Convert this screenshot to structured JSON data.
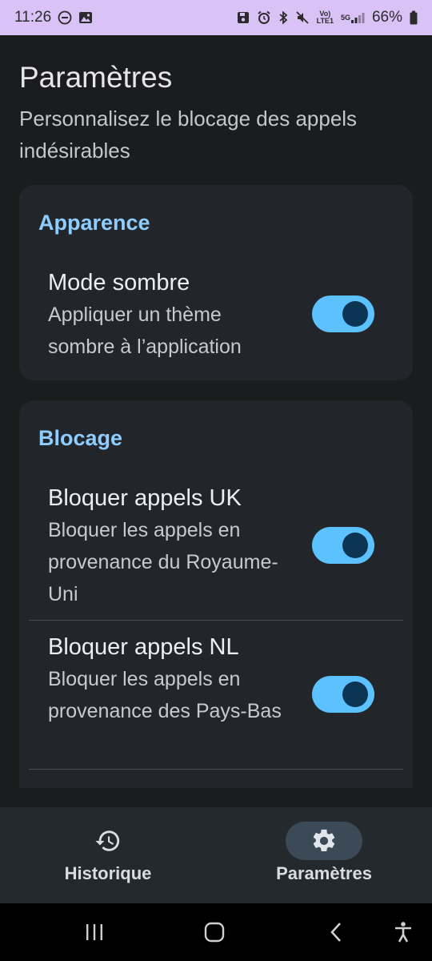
{
  "status_bar": {
    "time": "11:26",
    "network_top": "Vo)",
    "network_bottom": "LTE1",
    "signal_top": "5G",
    "battery": "66%",
    "icons": [
      "do-not-disturb-icon",
      "gallery-icon",
      "save-icon",
      "alarm-icon",
      "bluetooth-icon",
      "mute-icon",
      "signal-icon",
      "battery-icon"
    ]
  },
  "header": {
    "title": "Paramètres",
    "subtitle": "Personnalisez le blocage des appels indésirables"
  },
  "sections": [
    {
      "title": "Apparence",
      "settings": [
        {
          "title": "Mode sombre",
          "description": "Appliquer un thème sombre à l’application",
          "enabled": true
        }
      ]
    },
    {
      "title": "Blocage",
      "settings": [
        {
          "title": "Bloquer appels UK",
          "description": "Bloquer les appels en provenance du Royaume-Uni",
          "enabled": true
        },
        {
          "title": "Bloquer appels NL",
          "description": "Bloquer les appels en provenance des Pays-Bas",
          "enabled": true
        }
      ]
    }
  ],
  "bottom_nav": {
    "items": [
      {
        "label": "Historique",
        "icon": "history-icon",
        "active": false
      },
      {
        "label": "Paramètres",
        "icon": "settings-icon",
        "active": true
      }
    ]
  },
  "system_nav": {
    "buttons": [
      "recent-apps-icon",
      "home-icon",
      "back-icon",
      "accessibility-icon"
    ]
  },
  "colors": {
    "background": "#1a1c1e",
    "card": "#22262b",
    "accent": "#8fcdff",
    "toggle_track": "#5cc1ff",
    "toggle_knob": "#0c3553",
    "status_bar": "#d9c2f5"
  }
}
